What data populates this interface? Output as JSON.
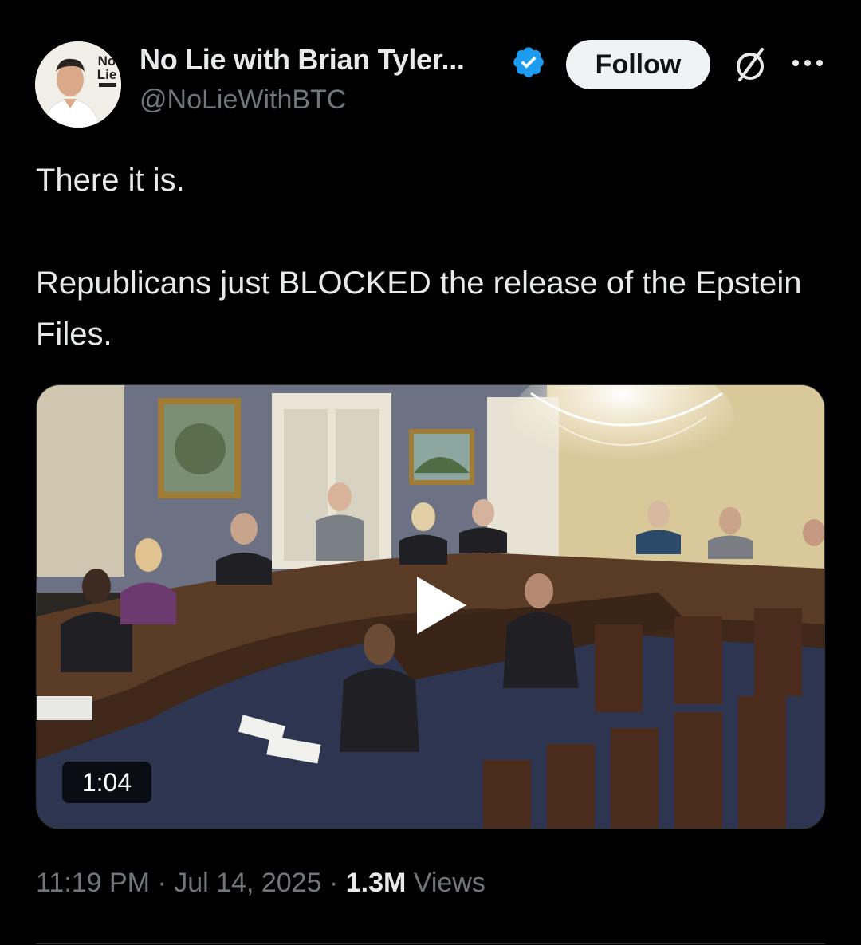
{
  "author": {
    "display_name": "No Lie with Brian Tyler...",
    "handle": "@NoLieWithBTC",
    "verified": true,
    "avatar_icon": "profile-avatar",
    "avatar_logo_line1": "No",
    "avatar_logo_line2": "Lie"
  },
  "actions": {
    "follow_label": "Follow",
    "grok_icon": "grok-icon",
    "more_icon": "more-icon"
  },
  "tweet": {
    "paragraphs": [
      "There it is.",
      "Republicans just BLOCKED the release of the Epstein Files."
    ]
  },
  "media": {
    "type": "video",
    "duration": "1:04",
    "play_icon": "play-icon"
  },
  "meta": {
    "time": "11:19 PM",
    "separator": " · ",
    "date": "Jul 14, 2025",
    "views_count": "1.3M",
    "views_label": "Views"
  },
  "colors": {
    "background": "#000000",
    "text_primary": "#e7e9ea",
    "text_secondary": "#71767b",
    "verified_blue": "#1d9bf0",
    "follow_bg": "#eff3f4"
  }
}
